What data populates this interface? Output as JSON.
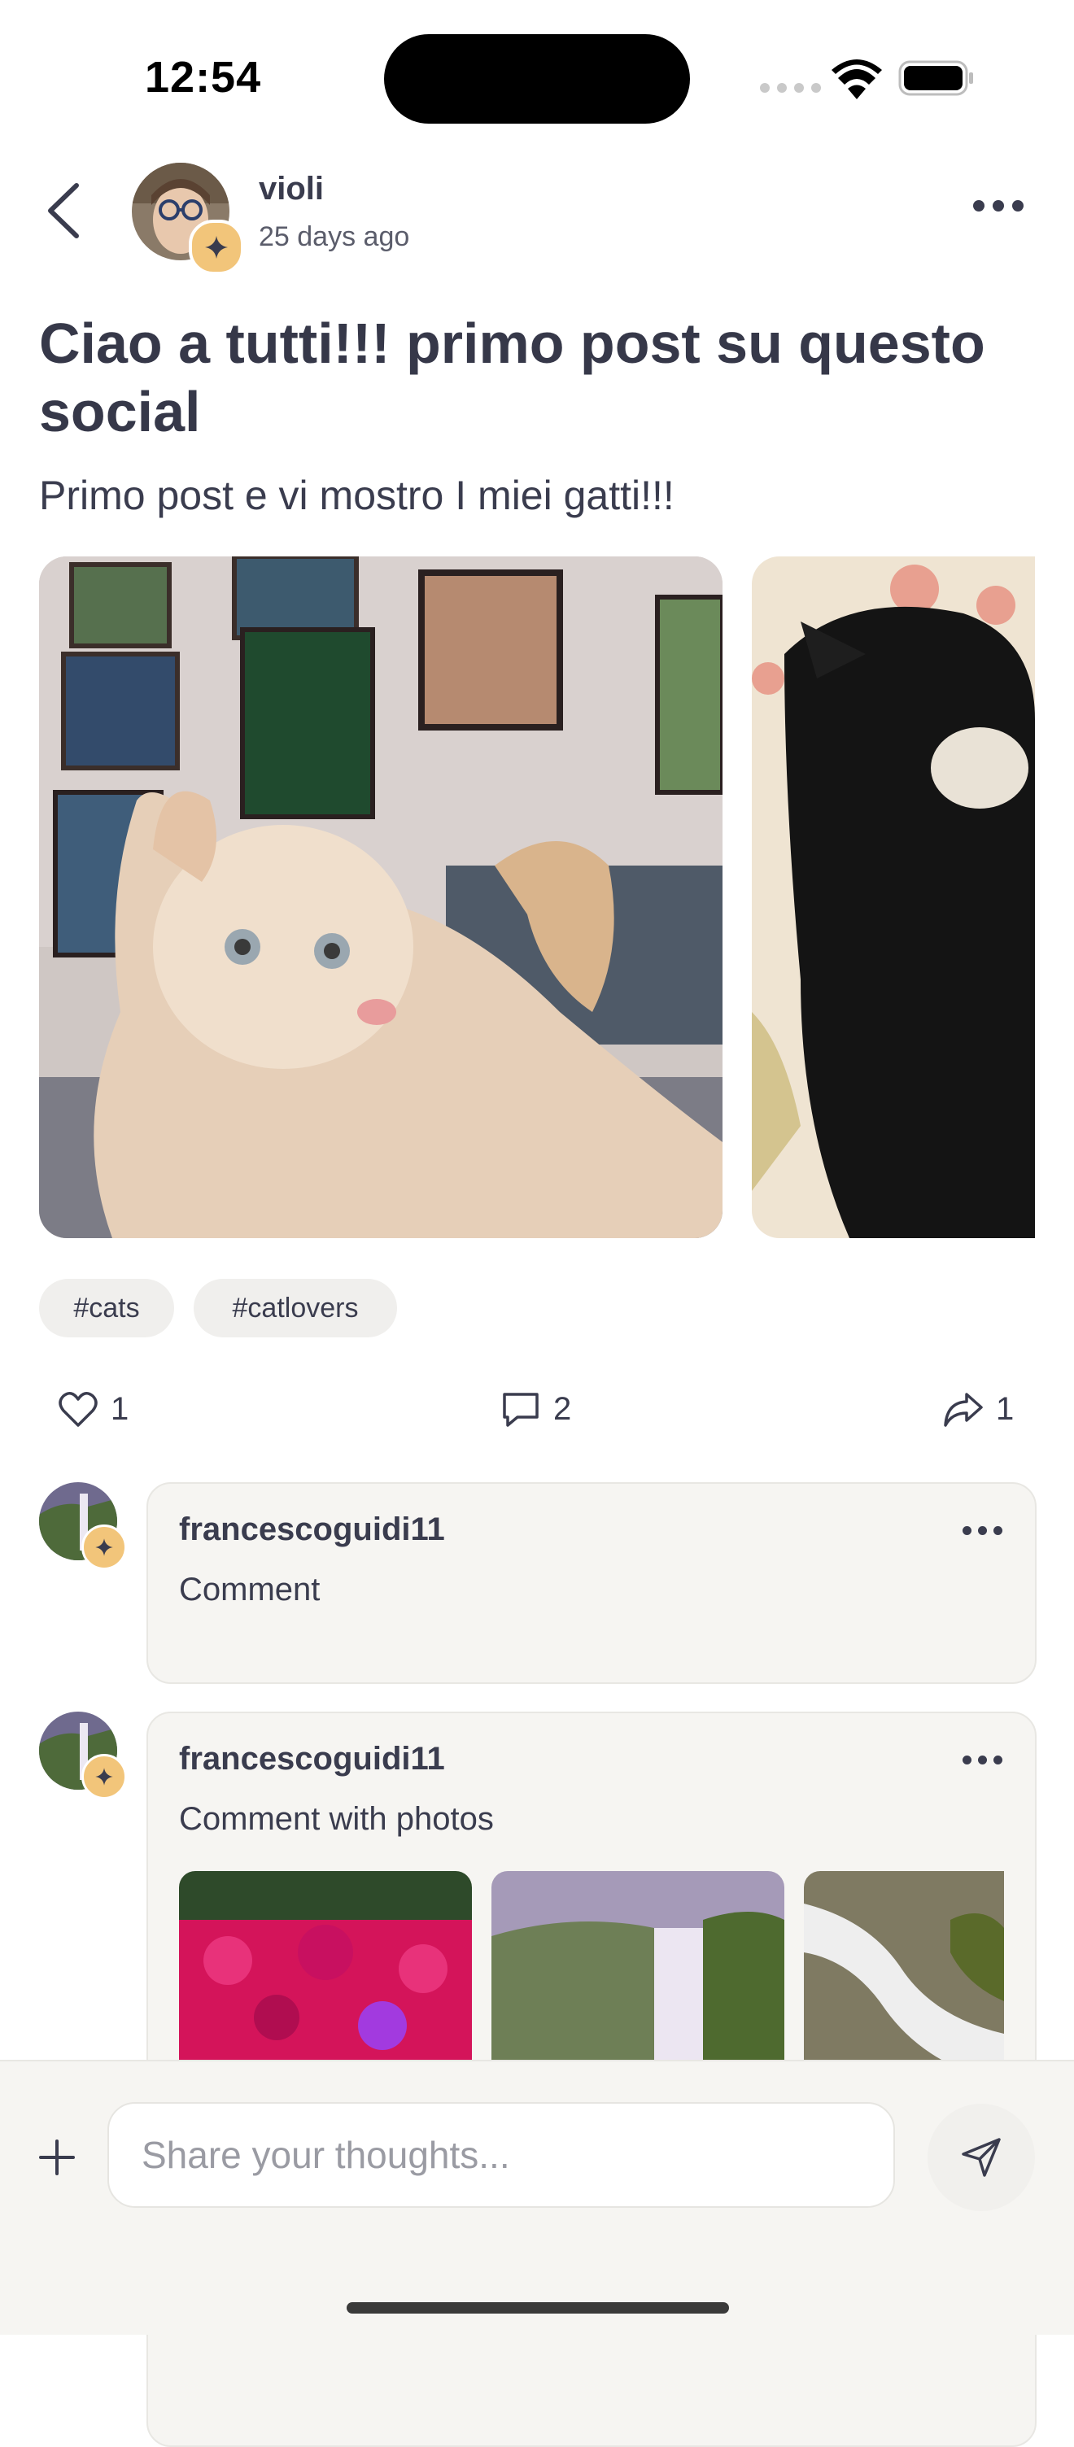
{
  "status_bar": {
    "time": "12:54"
  },
  "post": {
    "author": "violi",
    "time_ago": "25 days ago",
    "title": "Ciao a tutti!!! primo post su questo social",
    "body": "Primo post e vi mostro I miei gatti!!!",
    "tags": [
      "#cats",
      "#catlovers"
    ],
    "stats": {
      "likes": "1",
      "comments": "2",
      "shares": "1"
    }
  },
  "comments": [
    {
      "author": "francescoguidi11",
      "text": "Comment"
    },
    {
      "author": "francescoguidi11",
      "text": "Comment with photos"
    }
  ],
  "composer": {
    "placeholder": "Share your thoughts..."
  },
  "icons": {
    "back": "chevron-left-icon",
    "more": "more-horizontal-icon",
    "badge": "sparkle-icon",
    "like": "heart-icon",
    "comment": "comment-icon",
    "share": "share-icon",
    "plus": "plus-icon",
    "send": "send-icon"
  },
  "colors": {
    "text": "#2f3142",
    "badge": "#f2c57a",
    "card": "#f6f5f2",
    "tag": "#f0efed"
  }
}
